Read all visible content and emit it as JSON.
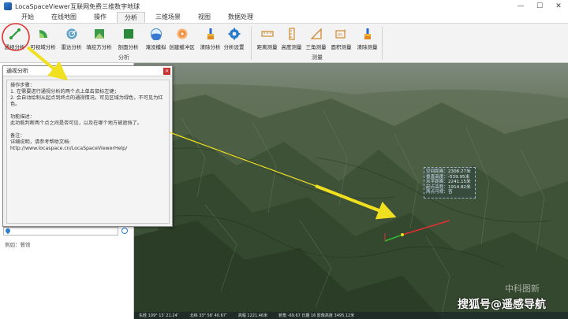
{
  "window": {
    "title": "LocaSpaceViewer互联网免费三维数字地球",
    "controls": [
      "—",
      "☐",
      "✕"
    ]
  },
  "menu": {
    "tabs": [
      "开始",
      "在线地图",
      "操作",
      "分析",
      "三维场景",
      "视图",
      "数据处理"
    ],
    "active_index": 3
  },
  "ribbon": {
    "analysis_buttons": [
      "通视分析",
      "可视域分析",
      "雷达分析",
      "填挖方分析",
      "剖面分析",
      "淹没模拟",
      "创建缓冲区",
      "清除分析",
      "分析设置"
    ],
    "analysis_group_label": "分析",
    "measure_buttons": [
      "距离测量",
      "高度测量",
      "三角测量",
      "面积测量",
      "清除测量"
    ],
    "measure_group_label": "测量"
  },
  "dialog": {
    "title": "通视分析",
    "close": "×",
    "lines": [
      "操作步骤：",
      "1. 在需要进行通视分析的两个点上单击鼠标左键；",
      "2. 会自动绘制从起点到终点的通视情况。可见区域为绿色，不可见为红色。",
      "",
      "功能描述：",
      "此功能判断两个点之间是否可见，以及在哪个地方被遮挡了。",
      "",
      "备注：",
      "详细说明，请参考帮助文档:",
      "http://www.locaspace.cn/LocaSpaceViewerHelp/"
    ]
  },
  "left_panel": {
    "search_value": "",
    "example_label": "例如：餐馆"
  },
  "infobox": {
    "rows": [
      {
        "k": "空间距离：",
        "v": "2306.27米"
      },
      {
        "k": "垂直高度：",
        "v": "-539.95米"
      },
      {
        "k": "水平距离：",
        "v": "2241.15米"
      },
      {
        "k": "起点高程：",
        "v": "1914.82米"
      },
      {
        "k": "两点可视：",
        "v": "否"
      }
    ]
  },
  "statusbar": [
    "东经 109° 13′ 21.24″",
    "北纬 33° 58′ 40.67″",
    "高程 1221.46米",
    "俯角 -69.67 日期 16 影像高度 3495.12米"
  ],
  "watermark": {
    "line1": "中科图新",
    "line2": "搜狐号@遥感导航"
  },
  "colors": {
    "accent": "#2a7fd4",
    "highlight_circle": "#e03030",
    "arrow": "#f0e020",
    "visible_line": "#30c030",
    "invisible_line": "#e03030"
  }
}
